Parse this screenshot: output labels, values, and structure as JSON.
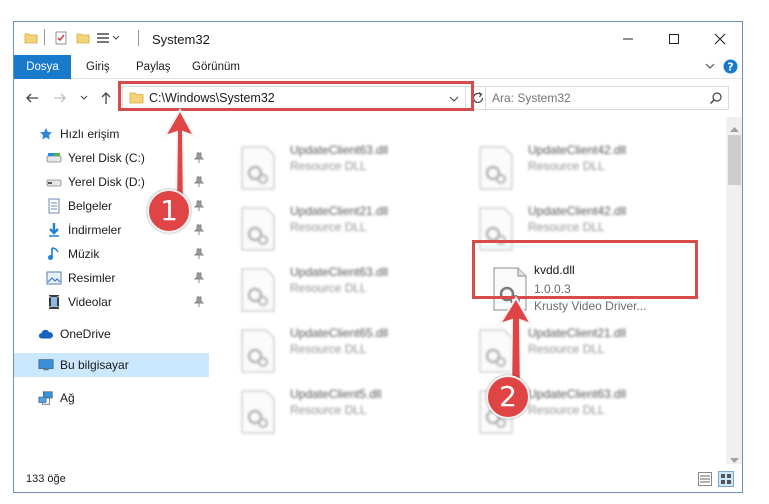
{
  "window": {
    "title": "System32"
  },
  "ribbon": {
    "tabs": [
      {
        "label": "Dosya",
        "active": true
      },
      {
        "label": "Giriş"
      },
      {
        "label": "Paylaş"
      },
      {
        "label": "Görünüm"
      }
    ]
  },
  "address": {
    "path": "C:\\Windows\\System32"
  },
  "search": {
    "placeholder": "Ara: System32"
  },
  "nav": {
    "items": [
      {
        "label": "Hızlı erişim",
        "icon": "star-icon"
      },
      {
        "label": "Yerel Disk (C:)",
        "icon": "drive-icon",
        "pinned": true
      },
      {
        "label": "Yerel Disk (D:)",
        "icon": "drive-icon",
        "pinned": true
      },
      {
        "label": "Belgeler",
        "icon": "documents-icon",
        "pinned": true
      },
      {
        "label": "İndirmeler",
        "icon": "download-icon",
        "pinned": true
      },
      {
        "label": "Müzik",
        "icon": "music-icon",
        "pinned": true
      },
      {
        "label": "Resimler",
        "icon": "pictures-icon",
        "pinned": true
      },
      {
        "label": "Videolar",
        "icon": "videos-icon",
        "pinned": true
      },
      {
        "label": "OneDrive",
        "icon": "cloud-icon"
      },
      {
        "label": "Bu bilgisayar",
        "icon": "computer-icon",
        "selected": true
      },
      {
        "label": "Ağ",
        "icon": "network-icon"
      }
    ]
  },
  "files": [
    {
      "name": "UpdateClient63.dll",
      "type": "Resource DLL"
    },
    {
      "name": "UpdateClient42.dll",
      "type": "Resource DLL"
    },
    {
      "name": "UpdateClient21.dll",
      "type": "Resource DLL"
    },
    {
      "name": "UpdateClient42.dll",
      "type": "Resource DLL"
    },
    {
      "name": "UpdateClient63.dll",
      "type": "Resource DLL"
    },
    {
      "name": "kvdd.dll",
      "version": "1.0.0.3",
      "description": "Krusty Video Driver...",
      "highlighted": true
    },
    {
      "name": "UpdateClient65.dll",
      "type": "Resource DLL"
    },
    {
      "name": "UpdateClient21.dll",
      "type": "Resource DLL"
    },
    {
      "name": "UpdateClient5.dll",
      "type": "Resource DLL"
    },
    {
      "name": "UpdateClient63.dll",
      "type": "Resource DLL"
    }
  ],
  "status": {
    "item_count": "133 öğe"
  },
  "annotations": {
    "badge1": "1",
    "badge2": "2",
    "color": "#d84b4b"
  },
  "colors": {
    "accent": "#1979ca",
    "selected": "#cce8ff"
  }
}
